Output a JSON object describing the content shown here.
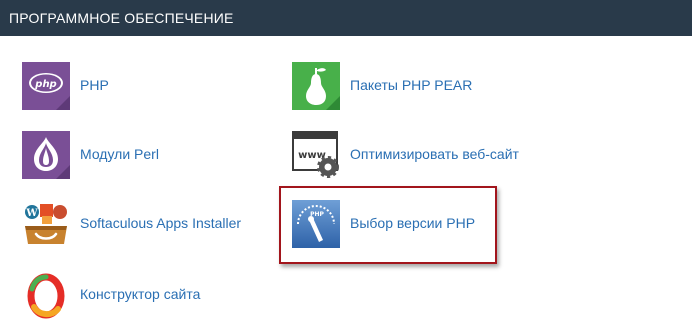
{
  "header": {
    "title": "ПРОГРАММНОЕ ОБЕСПЕЧЕНИЕ"
  },
  "items": [
    {
      "label": "PHP",
      "icon": "php-icon",
      "icon_text": "php"
    },
    {
      "label": "Пакеты PHP PEAR",
      "icon": "pear-icon"
    },
    {
      "label": "Модули Perl",
      "icon": "perl-onion-icon"
    },
    {
      "label": "Оптимизировать веб-сайт",
      "icon": "www-gear-icon",
      "icon_text": "www"
    },
    {
      "label": "Softaculous Apps Installer",
      "icon": "softaculous-icon"
    },
    {
      "label": "Выбор версии PHP",
      "icon": "php-selector-icon",
      "icon_text": "PHP"
    },
    {
      "label": "Конструктор сайта",
      "icon": "site-builder-icon"
    }
  ],
  "colors": {
    "header_bg": "#293a4a",
    "link": "#2a6fb3",
    "highlight_border": "#a2151c"
  }
}
